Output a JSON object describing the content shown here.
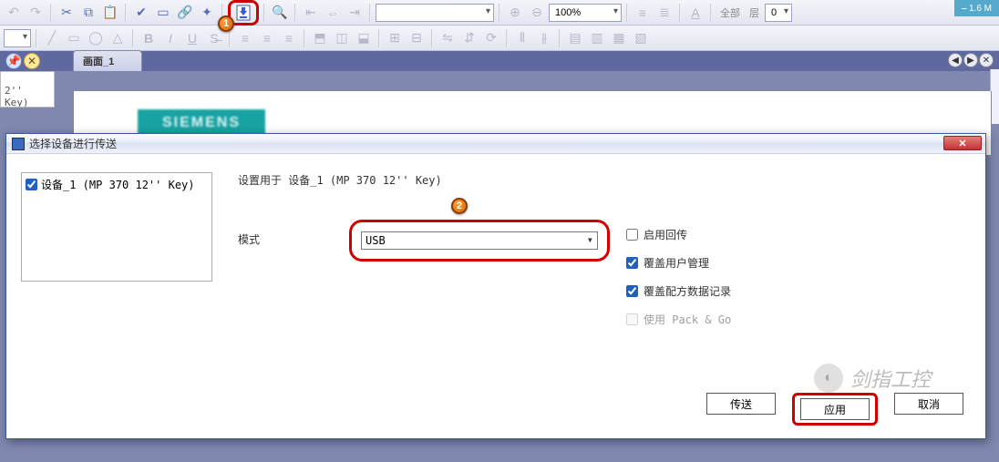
{
  "corner": {
    "label": "1.6 M"
  },
  "toolbar": {
    "zoom_value": "100%",
    "font_value": "",
    "text_all": "全部",
    "text_layer": "层",
    "layer_value": "0"
  },
  "tabs": {
    "active": "画面_1"
  },
  "left_sliver": {
    "text": "2'' Key)"
  },
  "canvas": {
    "brand": "SIEMENS"
  },
  "dialog": {
    "title": "选择设备进行传送",
    "device_list": {
      "items": [
        {
          "checked": true,
          "label": "设备_1 (MP 370 12'' Key)"
        }
      ]
    },
    "settings_for": "设置用于 设备_1 (MP 370 12'' Key)",
    "mode_label": "模式",
    "mode_value": "USB",
    "checkboxes": {
      "enable_back": {
        "checked": false,
        "label": "启用回传"
      },
      "overwrite_user": {
        "checked": true,
        "label": "覆盖用户管理"
      },
      "overwrite_recipe": {
        "checked": true,
        "label": "覆盖配方数据记录"
      },
      "use_packgo": {
        "checked": false,
        "label": "使用 Pack & Go",
        "disabled": true
      }
    },
    "buttons": {
      "transfer": "传送",
      "apply": "应用",
      "cancel": "取消"
    }
  },
  "badges": {
    "one": "1",
    "two": "2"
  },
  "watermark": {
    "text": "剑指工控"
  }
}
